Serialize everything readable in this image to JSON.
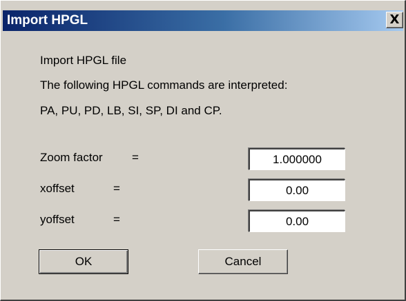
{
  "dialog": {
    "title": "Import HPGL",
    "close_glyph": "X"
  },
  "info": {
    "line1": "Import HPGL file",
    "line2": "The following HPGL commands are interpreted:",
    "line3": "PA, PU, PD, LB, SI, SP, DI and CP."
  },
  "fields": {
    "zoom": {
      "label": "Zoom factor",
      "eq": "=",
      "value": "1.000000"
    },
    "xoffset": {
      "label": "xoffset",
      "eq": "=",
      "value": "0.00"
    },
    "yoffset": {
      "label": "yoffset",
      "eq": "=",
      "value": "0.00"
    }
  },
  "buttons": {
    "ok": "OK",
    "cancel": "Cancel"
  },
  "colors": {
    "title_bar_start": "#0a246a",
    "title_bar_end": "#a6caf0",
    "dialog_face": "#d4d0c8"
  }
}
